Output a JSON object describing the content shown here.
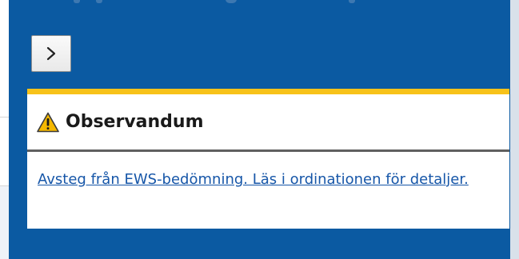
{
  "panel": {
    "expand_button": {
      "icon": "chevron-right-icon"
    },
    "notice": {
      "accent_color": "#f7c21a",
      "icon": "warning-triangle-icon",
      "title": "Observandum",
      "message_link": "Avsteg från EWS-bedömning. Läs i ordinationen för detaljer."
    }
  },
  "colors": {
    "panel_background": "#0b5aa2",
    "link": "#1656a8"
  }
}
